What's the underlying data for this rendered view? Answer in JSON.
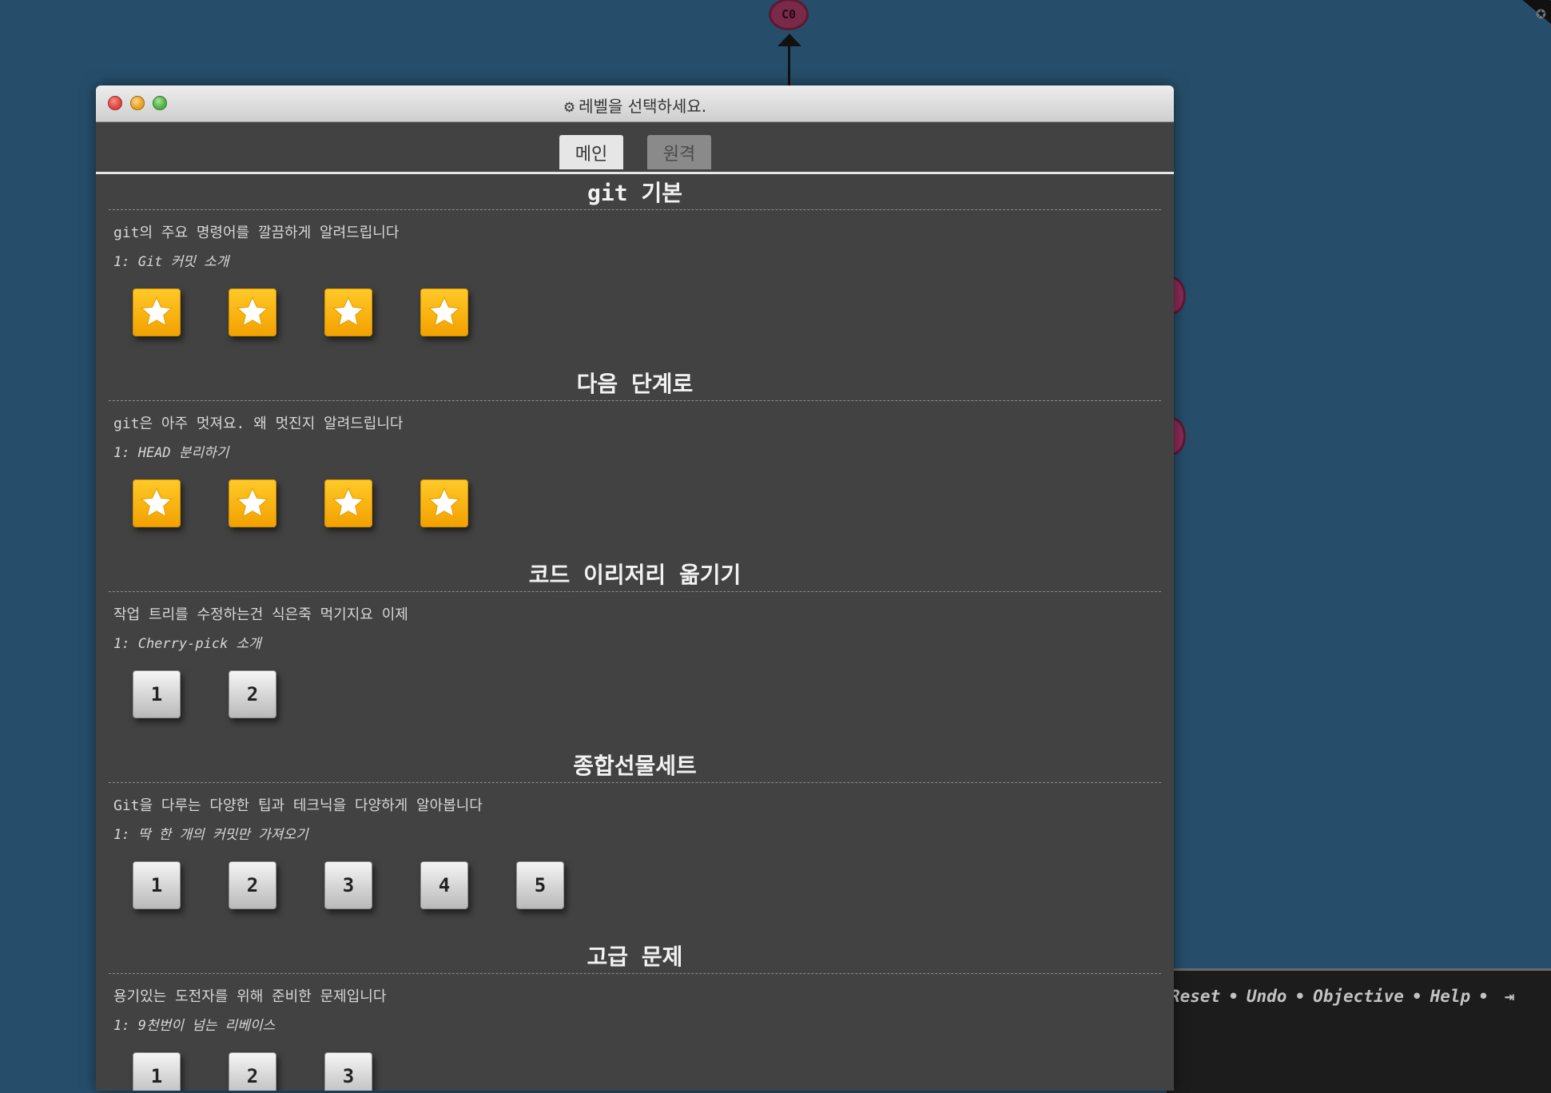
{
  "background": {
    "commit_label": "C0",
    "toolbar": {
      "links": [
        "Reset",
        "Undo",
        "Objective",
        "Help"
      ],
      "exit_icon": "exit-icon"
    }
  },
  "window": {
    "title": "레벨을 선택하세요.",
    "title_icon": "gear-icon",
    "tabs": [
      {
        "label": "메인",
        "active": true
      },
      {
        "label": "원격",
        "active": false
      }
    ]
  },
  "sequences": [
    {
      "title": "git 기본",
      "about": "git의 주요 명령어를 깔끔하게 알려드립니다",
      "level": "1: Git 커밋 소개",
      "completed": true,
      "count": 4
    },
    {
      "title": "다음 단계로",
      "about": "git은 아주 멋져요. 왜 멋진지 알려드립니다",
      "level": "1: HEAD 분리하기",
      "completed": true,
      "count": 4
    },
    {
      "title": "코드 이리저리 옮기기",
      "about": "작업 트리를 수정하는건 식은죽 먹기지요 이제",
      "level": "1: Cherry-pick 소개",
      "completed": false,
      "count": 2
    },
    {
      "title": "종합선물세트",
      "about": "Git을 다루는 다양한 팁과 테크닉을 다양하게 알아봅니다",
      "level": "1: 딱 한 개의 커밋만 가져오기",
      "completed": false,
      "count": 5
    },
    {
      "title": "고급 문제",
      "about": "용기있는 도전자를 위해 준비한 문제입니다",
      "level": "1: 9천번이 넘는 리베이스",
      "completed": false,
      "count": 3
    }
  ],
  "colors": {
    "background": "#264e6b",
    "modal": "#424242",
    "star": "#f7b500"
  }
}
